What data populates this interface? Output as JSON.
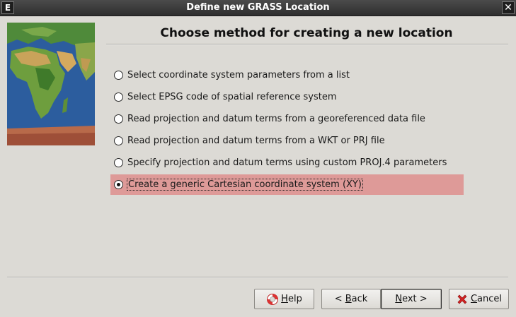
{
  "window": {
    "title": "Define new GRASS Location",
    "app_icon_label": "E",
    "close_label": "✕"
  },
  "heading": "Choose method for creating a new location",
  "options": [
    {
      "label": "Select coordinate system parameters from a list",
      "selected": false
    },
    {
      "label": "Select EPSG code of spatial reference system",
      "selected": false
    },
    {
      "label": "Read projection and datum terms from a georeferenced data file",
      "selected": false
    },
    {
      "label": "Read projection and datum terms from a WKT or PRJ file",
      "selected": false
    },
    {
      "label": "Specify projection and datum terms using custom PROJ.4 parameters",
      "selected": false
    },
    {
      "label": "Create a generic Cartesian coordinate system (XY)",
      "selected": true
    }
  ],
  "buttons": {
    "help": {
      "mnemonic": "H",
      "rest": "elp"
    },
    "back": {
      "prefix": "< ",
      "mnemonic": "B",
      "rest": "ack"
    },
    "next": {
      "mnemonic": "N",
      "rest": "ext >"
    },
    "cancel": {
      "mnemonic": "C",
      "rest": "ancel"
    }
  },
  "colors": {
    "selected_highlight": "#de9a98",
    "window_bg": "#dcdad5",
    "titlebar": "#3a3a3a"
  },
  "icons": {
    "map": "world-map-icon",
    "help": "lifebuoy-icon",
    "cancel": "red-x-icon"
  }
}
